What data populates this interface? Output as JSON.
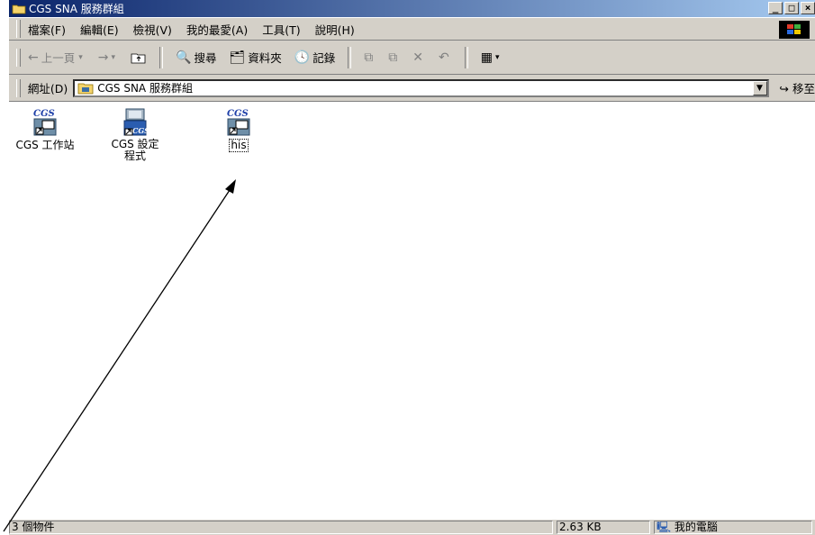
{
  "window": {
    "title": "CGS SNA 服務群組"
  },
  "menu": [
    "檔案(F)",
    "編輯(E)",
    "檢視(V)",
    "我的最愛(A)",
    "工具(T)",
    "說明(H)"
  ],
  "toolbar": {
    "back": "上一頁",
    "search": "搜尋",
    "folders": "資料夾",
    "history": "記錄"
  },
  "address": {
    "label": "網址(D)",
    "value": "CGS SNA 服務群組",
    "go": "移至"
  },
  "items": [
    {
      "label": "CGS 工作站",
      "icon": "cgs-shortcut-icon"
    },
    {
      "label": "CGS 設定程式",
      "icon": "cgs-setup-icon"
    },
    {
      "label": "his",
      "icon": "cgs-shortcut-icon"
    }
  ],
  "status": {
    "count": "3 個物件",
    "size": "2.63 KB",
    "zone": "我的電腦"
  },
  "colors": {
    "title_start": "#0a246a",
    "title_end": "#a6caf0",
    "chrome": "#d4d0c8"
  }
}
